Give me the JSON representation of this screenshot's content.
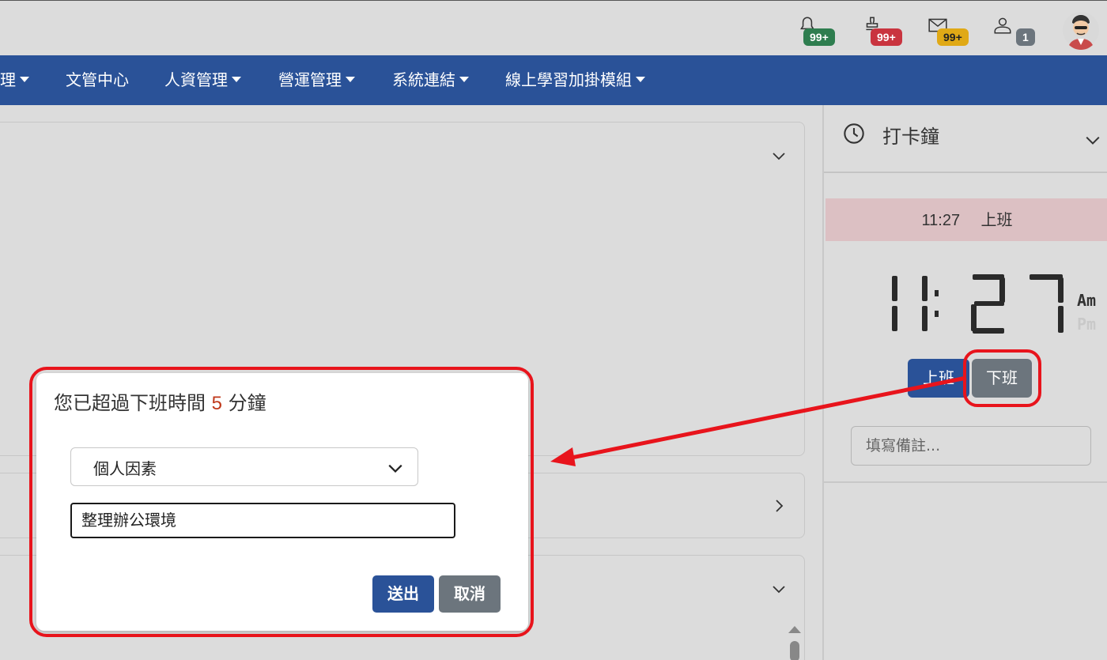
{
  "header": {
    "icons": [
      {
        "name": "bell-icon",
        "badge": "99+",
        "badge_color": "#2e7d4f"
      },
      {
        "name": "stamp-icon",
        "badge": "99+",
        "badge_color": "#c9343f"
      },
      {
        "name": "mail-icon",
        "badge": "99+",
        "badge_color": "#e0a916"
      },
      {
        "name": "user-icon",
        "badge": "1",
        "badge_color": "#6c757d"
      }
    ]
  },
  "nav": {
    "items": [
      {
        "label": "理",
        "has_caret": true
      },
      {
        "label": "文管中心",
        "has_caret": false
      },
      {
        "label": "人資管理",
        "has_caret": true
      },
      {
        "label": "營運管理",
        "has_caret": true
      },
      {
        "label": "系統連結",
        "has_caret": true
      },
      {
        "label": "線上學習加掛模組",
        "has_caret": true
      }
    ],
    "bg_color": "#2a5298"
  },
  "clock_widget": {
    "title": "打卡鐘",
    "status_time": "11:27",
    "status_label": "上班",
    "digital_time": "11:27",
    "am": "Am",
    "pm": "Pm",
    "clock_in_label": "上班",
    "clock_out_label": "下班",
    "note_placeholder": "填寫備註..."
  },
  "modal": {
    "title_prefix": "您已超過下班時間",
    "minutes": "5",
    "title_suffix": "分鐘",
    "reason_selected": "個人因素",
    "reason_text": "整理辦公環境",
    "submit_label": "送出",
    "cancel_label": "取消",
    "highlight_color": "#e8141c",
    "submit_color": "#2a5298",
    "cancel_color": "#6c757d"
  }
}
